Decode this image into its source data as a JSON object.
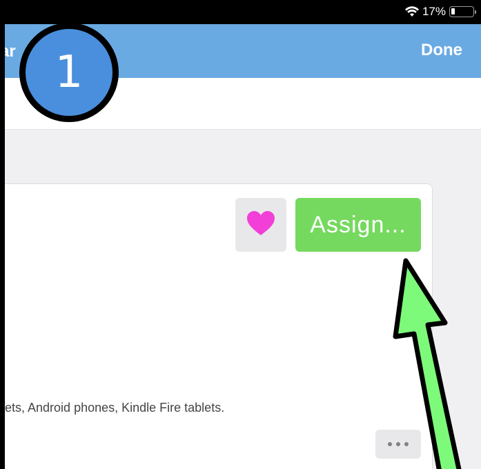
{
  "nav": {
    "back_label_fragment": "ar",
    "done_label": "Done"
  },
  "status": {
    "battery_percent_label": "17%",
    "battery_level": 0.17
  },
  "card": {
    "assign_label": "Assign...",
    "platforms_text": "ets, Android phones, Kindle Fire tablets.",
    "more_label": "..."
  },
  "annotation": {
    "step_number": "1"
  },
  "icons": {
    "favorite": "heart-icon",
    "wifi": "wifi-icon",
    "battery": "battery-icon",
    "more": "more-dots-icon"
  },
  "colors": {
    "nav_bar": "#6aaae3",
    "assign_button": "#75d95f",
    "heart": "#f23fd7",
    "annotation_arrow": "#7dfa7a",
    "step_badge": "#4a8fdd"
  }
}
